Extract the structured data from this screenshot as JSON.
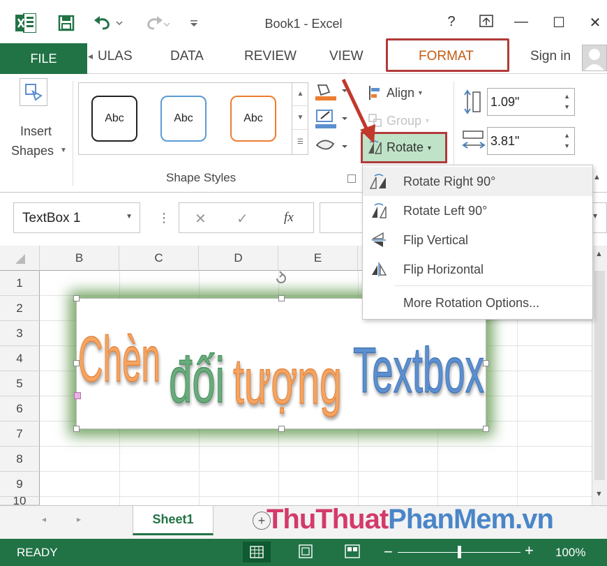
{
  "titlebar": {
    "title": "Book1 - Excel",
    "help": "?",
    "minimize": "—",
    "maximize": "☐",
    "close": "✕"
  },
  "tabs": {
    "file": "FILE",
    "formulas": "ULAS",
    "data": "DATA",
    "review": "REVIEW",
    "view": "VIEW",
    "format": "FORMAT",
    "signin": "Sign in"
  },
  "ribbon": {
    "insert_shapes_line1": "Insert",
    "insert_shapes_line2": "Shapes",
    "style_samples": [
      "Abc",
      "Abc",
      "Abc"
    ],
    "style_colors": [
      "#222222",
      "#5b9bd5",
      "#ed7d31"
    ],
    "shape_styles_label": "Shape Styles",
    "align": "Align",
    "group": "Group",
    "rotate": "Rotate",
    "height": "1.09\"",
    "width": "3.81\""
  },
  "formula": {
    "namebox": "TextBox 1",
    "cancel": "✕",
    "enter": "✓",
    "fx": "fx"
  },
  "grid": {
    "columns": [
      "B",
      "C",
      "D",
      "E"
    ],
    "rows": [
      "1",
      "2",
      "3",
      "4",
      "5",
      "6",
      "7",
      "8",
      "9",
      "10"
    ]
  },
  "textbox": {
    "words": [
      "Chèn",
      "đối",
      "tượng",
      "Textbox"
    ],
    "colors": [
      "#f4a460",
      "#6aab7c",
      "#f4a460",
      "#5b8fd0"
    ]
  },
  "rotate_menu": {
    "items": [
      {
        "label": "Rotate Right 90°",
        "icon": "rotate-right-icon"
      },
      {
        "label": "Rotate Left 90°",
        "icon": "rotate-left-icon"
      },
      {
        "label": "Flip Vertical",
        "icon": "flip-vertical-icon"
      },
      {
        "label": "Flip Horizontal",
        "icon": "flip-horizontal-icon"
      },
      {
        "label": "More Rotation Options...",
        "icon": ""
      }
    ]
  },
  "sheets": {
    "active": "Sheet1",
    "add": "+"
  },
  "watermark": {
    "part1": "ThuThuat",
    "part2": "PhanMem",
    "part3": ".vn",
    "color1": "#d33a6a",
    "color2": "#4a86c8"
  },
  "status": {
    "ready": "READY",
    "zoom": "100%",
    "zoom_level": 1.0
  },
  "colors": {
    "excel_green": "#217346",
    "format_orange": "#c55a11",
    "highlight_red": "#b23a3a"
  }
}
